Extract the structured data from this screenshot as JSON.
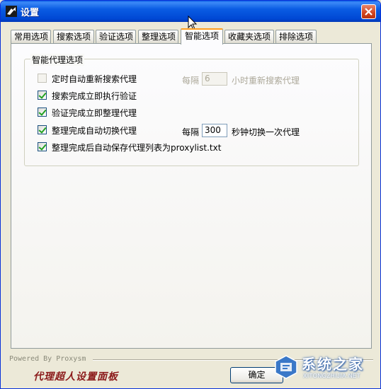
{
  "window": {
    "title": "设置"
  },
  "tabs": [
    {
      "label": "常用选项",
      "active": false
    },
    {
      "label": "搜索选项",
      "active": false
    },
    {
      "label": "验证选项",
      "active": false
    },
    {
      "label": "整理选项",
      "active": false
    },
    {
      "label": "智能选项",
      "active": true
    },
    {
      "label": "收藏夹选项",
      "active": false
    },
    {
      "label": "排除选项",
      "active": false
    }
  ],
  "group": {
    "title": "智能代理选项",
    "options": [
      {
        "label": "定时自动重新搜索代理",
        "checked": false,
        "enabled": false
      },
      {
        "label": "搜索完成立即执行验证",
        "checked": true,
        "enabled": true
      },
      {
        "label": "验证完成立即整理代理",
        "checked": true,
        "enabled": true
      },
      {
        "label": "整理完成自动切换代理",
        "checked": true,
        "enabled": true
      },
      {
        "label": "整理完成后自动保存代理列表为proxylist.txt",
        "checked": true,
        "enabled": true
      }
    ],
    "research_interval": {
      "prefix": "每隔",
      "value": "6",
      "suffix": "小时重新搜索代理"
    },
    "switch_interval": {
      "prefix": "每隔",
      "value": "300",
      "suffix": "秒钟切换一次代理"
    }
  },
  "footer": {
    "powered_by": "Powered By Proxysm",
    "brand": "代理超人设置面板",
    "ok_label": "确定"
  },
  "watermark": {
    "text": "系统之家",
    "sub": "XITONGZHIJIA.NET"
  },
  "colors": {
    "title_bar": "#0a5ce3",
    "tab_highlight": "#ff9e1f",
    "brand_text": "#8b1a1a",
    "close_button": "#d1441e"
  }
}
